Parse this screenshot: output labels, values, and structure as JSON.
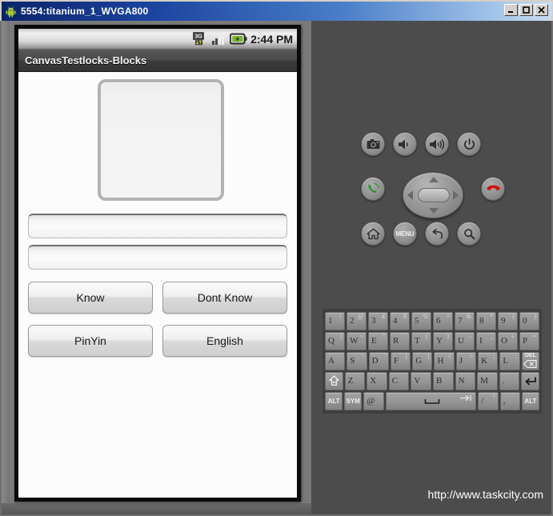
{
  "window": {
    "title": "5554:titanium_1_WVGA800",
    "icon": "android-robot-icon",
    "controls": [
      {
        "name": "minimize-button",
        "label": "_"
      },
      {
        "name": "maximize-button",
        "label": "□"
      },
      {
        "name": "close-button",
        "label": "X"
      }
    ]
  },
  "device": {
    "statusbar": {
      "clock": "2:44 PM",
      "icons": [
        "3g-data-icon",
        "signal-strength-icon",
        "battery-charging-icon"
      ]
    },
    "app_title": "CanvasTestlocks-Blocks",
    "content": {
      "canvas": {
        "name": "drawing-canvas",
        "value": ""
      },
      "fields": [
        {
          "name": "text-field-1",
          "value": "",
          "placeholder": ""
        },
        {
          "name": "text-field-2",
          "value": "",
          "placeholder": ""
        }
      ],
      "buttons": [
        {
          "name": "know-button",
          "label": "Know"
        },
        {
          "name": "dont-know-button",
          "label": "Dont Know"
        },
        {
          "name": "pinyin-button",
          "label": "PinYin"
        },
        {
          "name": "english-button",
          "label": "English"
        }
      ]
    }
  },
  "hardware": {
    "buttons": [
      {
        "name": "camera-button",
        "icon": "camera-icon"
      },
      {
        "name": "volume-down-button",
        "icon": "volume-down-icon"
      },
      {
        "name": "volume-up-button",
        "icon": "volume-up-icon"
      },
      {
        "name": "power-button",
        "icon": "power-icon"
      },
      {
        "name": "call-button",
        "icon": "phone-call-icon"
      },
      {
        "name": "end-call-button",
        "icon": "phone-hangup-icon"
      },
      {
        "name": "home-button",
        "icon": "home-icon"
      },
      {
        "name": "menu-button",
        "icon": "menu-icon",
        "label": "MENU"
      },
      {
        "name": "back-button",
        "icon": "back-arrow-icon"
      },
      {
        "name": "search-button",
        "icon": "search-icon"
      }
    ],
    "dpad": {
      "name": "dpad",
      "directions": [
        "up",
        "down",
        "left",
        "right"
      ],
      "center": "dpad-select"
    }
  },
  "keyboard": {
    "rows": [
      [
        {
          "main": "1",
          "sub": "!"
        },
        {
          "main": "2",
          "sub": "@"
        },
        {
          "main": "3",
          "sub": "#"
        },
        {
          "main": "4",
          "sub": "$"
        },
        {
          "main": "5",
          "sub": "%"
        },
        {
          "main": "6",
          "sub": "^"
        },
        {
          "main": "7",
          "sub": "&"
        },
        {
          "main": "8",
          "sub": "*"
        },
        {
          "main": "9",
          "sub": "("
        },
        {
          "main": "0",
          "sub": ")"
        }
      ],
      [
        {
          "main": "Q",
          "sub": "|"
        },
        {
          "main": "W",
          "sub": "~"
        },
        {
          "main": "E",
          "sub": "\""
        },
        {
          "main": "R",
          "sub": "`"
        },
        {
          "main": "T",
          "sub": "{"
        },
        {
          "main": "Y",
          "sub": "}"
        },
        {
          "main": "U",
          "sub": "-"
        },
        {
          "main": "I",
          "sub": "_"
        },
        {
          "main": "O",
          "sub": "+"
        },
        {
          "main": "P",
          "sub": "="
        }
      ],
      [
        {
          "main": "A",
          "sub": ""
        },
        {
          "main": "S",
          "sub": "\\"
        },
        {
          "main": "D",
          "sub": "'"
        },
        {
          "main": "F",
          "sub": "["
        },
        {
          "main": "G",
          "sub": "]"
        },
        {
          "main": "H",
          "sub": "<"
        },
        {
          "main": "J",
          "sub": ">"
        },
        {
          "main": "K",
          "sub": ";"
        },
        {
          "main": "L",
          "sub": ":"
        },
        {
          "main": "DEL",
          "sub": "",
          "icon": "backspace-icon"
        }
      ],
      [
        {
          "main": "",
          "sub": "",
          "icon": "shift-icon"
        },
        {
          "main": "Z",
          "sub": ""
        },
        {
          "main": "X",
          "sub": ""
        },
        {
          "main": "C",
          "sub": ""
        },
        {
          "main": "V",
          "sub": ""
        },
        {
          "main": "B",
          "sub": ""
        },
        {
          "main": "N",
          "sub": ""
        },
        {
          "main": "M",
          "sub": ""
        },
        {
          "main": ".",
          "sub": ""
        },
        {
          "main": "",
          "sub": "",
          "icon": "enter-icon"
        }
      ],
      [
        {
          "main": "ALT",
          "sub": ""
        },
        {
          "main": "SYM",
          "sub": ""
        },
        {
          "main": "@",
          "sub": ""
        },
        {
          "main": "",
          "sub": "",
          "icon": "space-icon"
        },
        {
          "main": "/",
          "sub": "?"
        },
        {
          "main": ",",
          "sub": ""
        },
        {
          "main": "ALT",
          "sub": ""
        }
      ]
    ]
  },
  "watermark": "http://www.taskcity.com",
  "colors": {
    "titlebar_start": "#0a246a",
    "titlebar_end": "#c9dcf0",
    "panel_left": "#7a7a7a",
    "panel_right": "#4c4c4c",
    "keyboard_bg": "#3f3f3f",
    "call_green": "#1f9c2a",
    "hangup_red": "#cc1111"
  }
}
